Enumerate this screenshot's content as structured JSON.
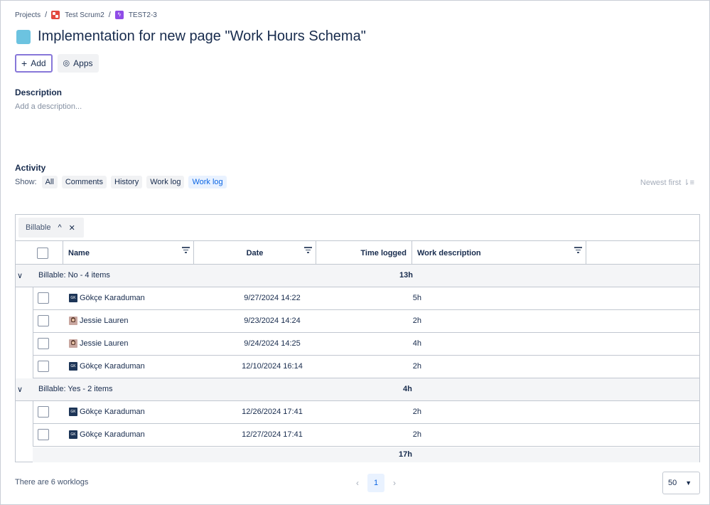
{
  "breadcrumb": {
    "projects": "Projects",
    "project": "Test Scrum2",
    "issue_key": "TEST2-3"
  },
  "title": "Implementation for new page \"Work Hours Schema\"",
  "buttons": {
    "add": "Add",
    "apps": "Apps"
  },
  "description": {
    "label": "Description",
    "placeholder": "Add a description..."
  },
  "activity": {
    "label": "Activity",
    "show_label": "Show:",
    "filters": [
      "All",
      "Comments",
      "History",
      "Work log",
      "Work log"
    ],
    "active_filter_index": 4,
    "sort_label": "Newest first"
  },
  "grid": {
    "group_chip": "Billable",
    "columns": {
      "name": "Name",
      "date": "Date",
      "time_logged": "Time logged",
      "work_description": "Work description"
    },
    "groups": [
      {
        "label": "Billable: No - 4 items",
        "sum": "13h",
        "rows": [
          {
            "name": "Gökçe Karaduman",
            "avatar": "GK",
            "date": "9/27/2024 14:22",
            "time": "5h"
          },
          {
            "name": "Jessie Lauren",
            "avatar": "photo",
            "date": "9/23/2024 14:24",
            "time": "2h"
          },
          {
            "name": "Jessie Lauren",
            "avatar": "photo",
            "date": "9/24/2024 14:25",
            "time": "4h"
          },
          {
            "name": "Gökçe Karaduman",
            "avatar": "GK",
            "date": "12/10/2024 16:14",
            "time": "2h"
          }
        ]
      },
      {
        "label": "Billable: Yes - 2 items",
        "sum": "4h",
        "rows": [
          {
            "name": "Gökçe Karaduman",
            "avatar": "GK",
            "date": "12/26/2024 17:41",
            "time": "2h"
          },
          {
            "name": "Gökçe Karaduman",
            "avatar": "GK",
            "date": "12/27/2024 17:41",
            "time": "2h"
          }
        ]
      }
    ],
    "total": "17h"
  },
  "footer": {
    "count_text": "There are 6 worklogs",
    "current_page": "1",
    "page_size": "50"
  }
}
